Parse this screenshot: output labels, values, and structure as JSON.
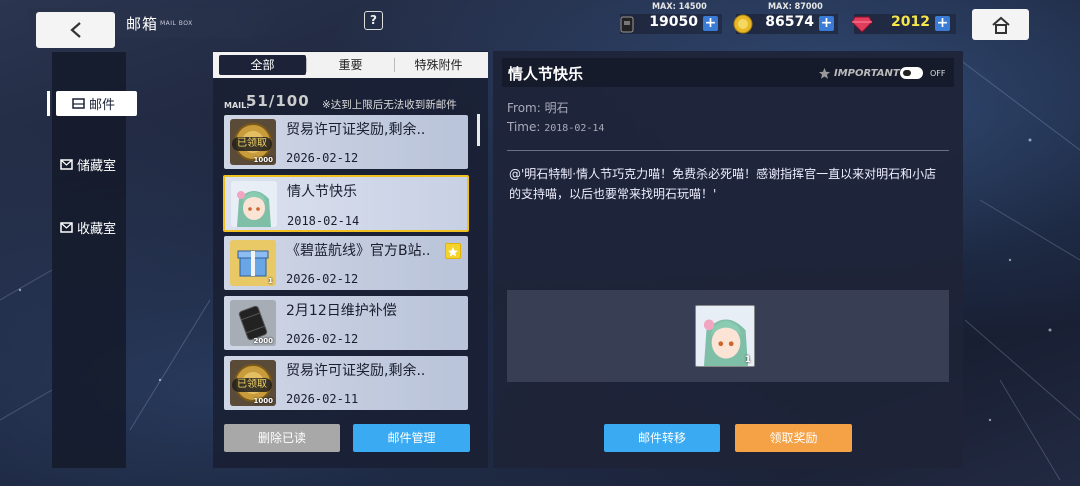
{
  "header": {
    "title": "邮箱",
    "subtitle": "MAIL BOX",
    "help_glyph": "?"
  },
  "resources": [
    {
      "name": "oil",
      "max_label": "MAX: 14500",
      "value": "19050",
      "icon": "oil-icon"
    },
    {
      "name": "coins",
      "max_label": "MAX: 87000",
      "value": "86574",
      "icon": "coin-icon"
    },
    {
      "name": "gems",
      "max_label": "",
      "value": "2012",
      "icon": "gem-icon"
    }
  ],
  "nav": {
    "items": [
      {
        "label": "邮件",
        "icon": "mail-icon",
        "active": true
      },
      {
        "label": "储藏室",
        "icon": "storage-icon",
        "active": false
      },
      {
        "label": "收藏室",
        "icon": "collection-icon",
        "active": false
      }
    ]
  },
  "tabs": [
    "全部",
    "重要",
    "特殊附件"
  ],
  "mailbox": {
    "count_label": "MAIL:",
    "count": "51/100",
    "limit_note": "※达到上限后无法收到新邮件",
    "items": [
      {
        "title": "贸易许可证奖励,剩余..",
        "date": "2026-02-12",
        "thumb": "trade-permit-icon",
        "claimed": "已领取",
        "qty": "1000"
      },
      {
        "title": "情人节快乐",
        "date": "2018-02-14",
        "thumb": "character-portrait",
        "selected": true
      },
      {
        "title": "《碧蓝航线》官方B站..",
        "date": "2026-02-12",
        "thumb": "gift-box-icon",
        "qty": "1",
        "important": true
      },
      {
        "title": "2月12日维护补偿",
        "date": "2026-02-12",
        "thumb": "oil-barrel-icon",
        "qty": "2000"
      },
      {
        "title": "贸易许可证奖励,剩余..",
        "date": "2026-02-11",
        "thumb": "trade-permit-icon",
        "claimed": "已领取",
        "qty": "1000"
      }
    ],
    "delete_read_label": "删除已读",
    "manage_label": "邮件管理"
  },
  "detail": {
    "title": "情人节快乐",
    "important_label": "IMPORTANT",
    "toggle_state": "OFF",
    "from_label": "From:",
    "from": "明石",
    "time_label": "Time:",
    "time": "2018-02-14",
    "content": "@'明石特制·情人节巧克力喵！免费杀必死喵！感谢指挥官一直以来对明石和小店的支持喵，以后也要常来找明石玩喵！'",
    "attachment_qty": "1",
    "transfer_label": "邮件转移",
    "claim_label": "领取奖励"
  },
  "colors": {
    "accent_blue": "#3aaaf2",
    "accent_orange": "#f4a245",
    "selected_border": "#f0c020",
    "panel": "#1e2438"
  }
}
